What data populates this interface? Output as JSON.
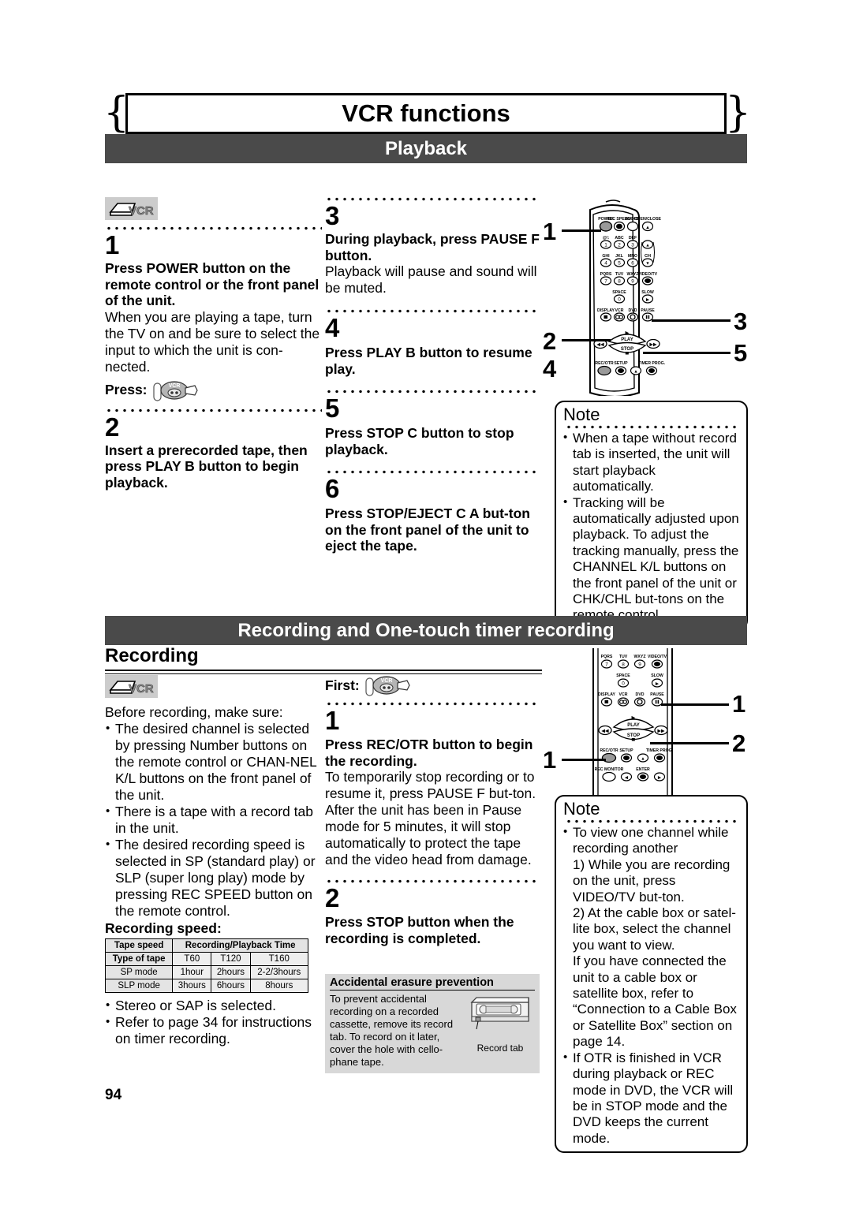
{
  "page": {
    "number": "94",
    "title": "VCR functions"
  },
  "playback": {
    "section_title": "Playback",
    "badge_icon": "vcr-device-icon",
    "badge_label": "VCR",
    "steps": [
      {
        "num": "1",
        "lead": "Press POWER button on the remote control or the front panel of the unit.",
        "body": "When you are playing a tape, turn the TV on and be sure to select the input to which the unit is con-nected.",
        "press_label": "Press:",
        "press_icon": "hand-press-vcr-icon"
      },
      {
        "num": "2",
        "lead": "Insert a prerecorded tape, then press PLAY B button to begin playback."
      },
      {
        "num": "3",
        "lead": "During playback, press PAUSE F button.",
        "body": "Playback will pause and sound will be muted."
      },
      {
        "num": "4",
        "lead": "Press PLAY B button to resume play."
      },
      {
        "num": "5",
        "lead": "Press STOP C button to stop playback."
      },
      {
        "num": "6",
        "lead": "Press STOP/EJECT C A but-ton on the front panel of the unit to eject the tape."
      }
    ],
    "note": {
      "title": "Note",
      "items": [
        "When a tape without record tab is inserted, the unit will start playback automatically.",
        "Tracking will be automatically adjusted upon playback. To adjust the tracking manually, press the CHANNEL K/L buttons on the front panel of the unit or CHK/CHL but-tons on the remote control."
      ]
    },
    "remote_callouts": [
      "1",
      "2",
      "3",
      "4",
      "5"
    ]
  },
  "recording": {
    "section_title": "Recording and One-touch timer recording",
    "sub_title": "Recording",
    "badge_icon": "vcr-device-icon",
    "badge_label": "VCR",
    "intro": "Before recording, make sure:",
    "checklist": [
      "The desired channel is selected by pressing Number buttons on the remote control or CHAN-NEL K/L buttons on the front panel of the unit.",
      "There is a tape with a record tab in the unit.",
      "The desired recording speed is selected in SP (standard play) or SLP (super long play) mode by pressing REC SPEED button on the remote control."
    ],
    "speed_label": "Recording speed:",
    "after_table": [
      "Stereo or SAP is selected.",
      "Refer to page 34 for instructions on timer recording."
    ],
    "first_label": "First:",
    "first_icon": "hand-press-vcr-icon",
    "steps": [
      {
        "num": "1",
        "lead": "Press REC/OTR button to begin the recording.",
        "body": "To temporarily stop recording or to resume it, press PAUSE F but-ton. After the unit has been in Pause mode for 5 minutes, it will stop automatically to protect the tape and the video head from damage."
      },
      {
        "num": "2",
        "lead": "Press STOP button when the recording is completed."
      }
    ],
    "erasure": {
      "title": "Accidental erasure prevention",
      "body": "To prevent accidental recording on a recorded cassette, remove its record tab. To record on it later, cover the hole with cello-phane tape.",
      "caption": "Record tab",
      "icon": "vhs-cassette-icon"
    },
    "note": {
      "title": "Note",
      "items": [
        "To view one channel while recording another",
        "1) While you are recording on the unit, press VIDEO/TV but-ton.",
        "2) At the cable box or satel-lite box, select the channel you want to view.",
        "If you have connected the unit to a cable box or satellite box, refer to “Connection to a Cable Box or Satellite Box” section on page 14.",
        "If OTR is finished in VCR during playback or REC mode in DVD, the VCR will be in STOP mode and the DVD keeps the current mode."
      ]
    },
    "remote_callouts": [
      "1",
      "2",
      "1"
    ]
  },
  "rec_speed_table": {
    "header_left": "Tape speed",
    "header_right": "Recording/Playback Time",
    "row_label": "Type of tape",
    "tape_types": [
      "T60",
      "T120",
      "T160"
    ],
    "rows": [
      {
        "mode": "SP mode",
        "values": [
          "1hour",
          "2hours",
          "2-2/3hours"
        ]
      },
      {
        "mode": "SLP mode",
        "values": [
          "3hours",
          "6hours",
          "8hours"
        ]
      }
    ]
  },
  "remote_keys": {
    "row_top": [
      "POWER",
      "REC SPEED",
      "AUDIO",
      "OPEN/CLOSE"
    ],
    "letters_1": [
      "@!:",
      "ABC",
      "DEF"
    ],
    "letters_2": [
      "GHI",
      "JKL",
      "MNO"
    ],
    "letters_3": [
      "PQRS",
      "TUV",
      "WXYZ",
      "VIDEO/TV"
    ],
    "space": "SPACE",
    "slow": "SLOW",
    "row_mode": [
      "DISPLAY",
      "VCR",
      "DVD",
      "PAUSE"
    ],
    "ch": "CH",
    "play": "PLAY",
    "stop": "STOP",
    "row_bottom": [
      "REC/OTR",
      "SETUP",
      "TIMER PROG."
    ],
    "rec_monitor": "REC MONITOR",
    "enter": "ENTER",
    "digits": [
      "1",
      "2",
      "3",
      "4",
      "5",
      "6",
      "7",
      "8",
      "9",
      "0"
    ]
  },
  "colors": {
    "section_bar": "#4a4a4a",
    "badge_bg": "#cccccc",
    "erasure_bg": "#d8d8d8",
    "table_header_bg": "#e4e4e4"
  }
}
